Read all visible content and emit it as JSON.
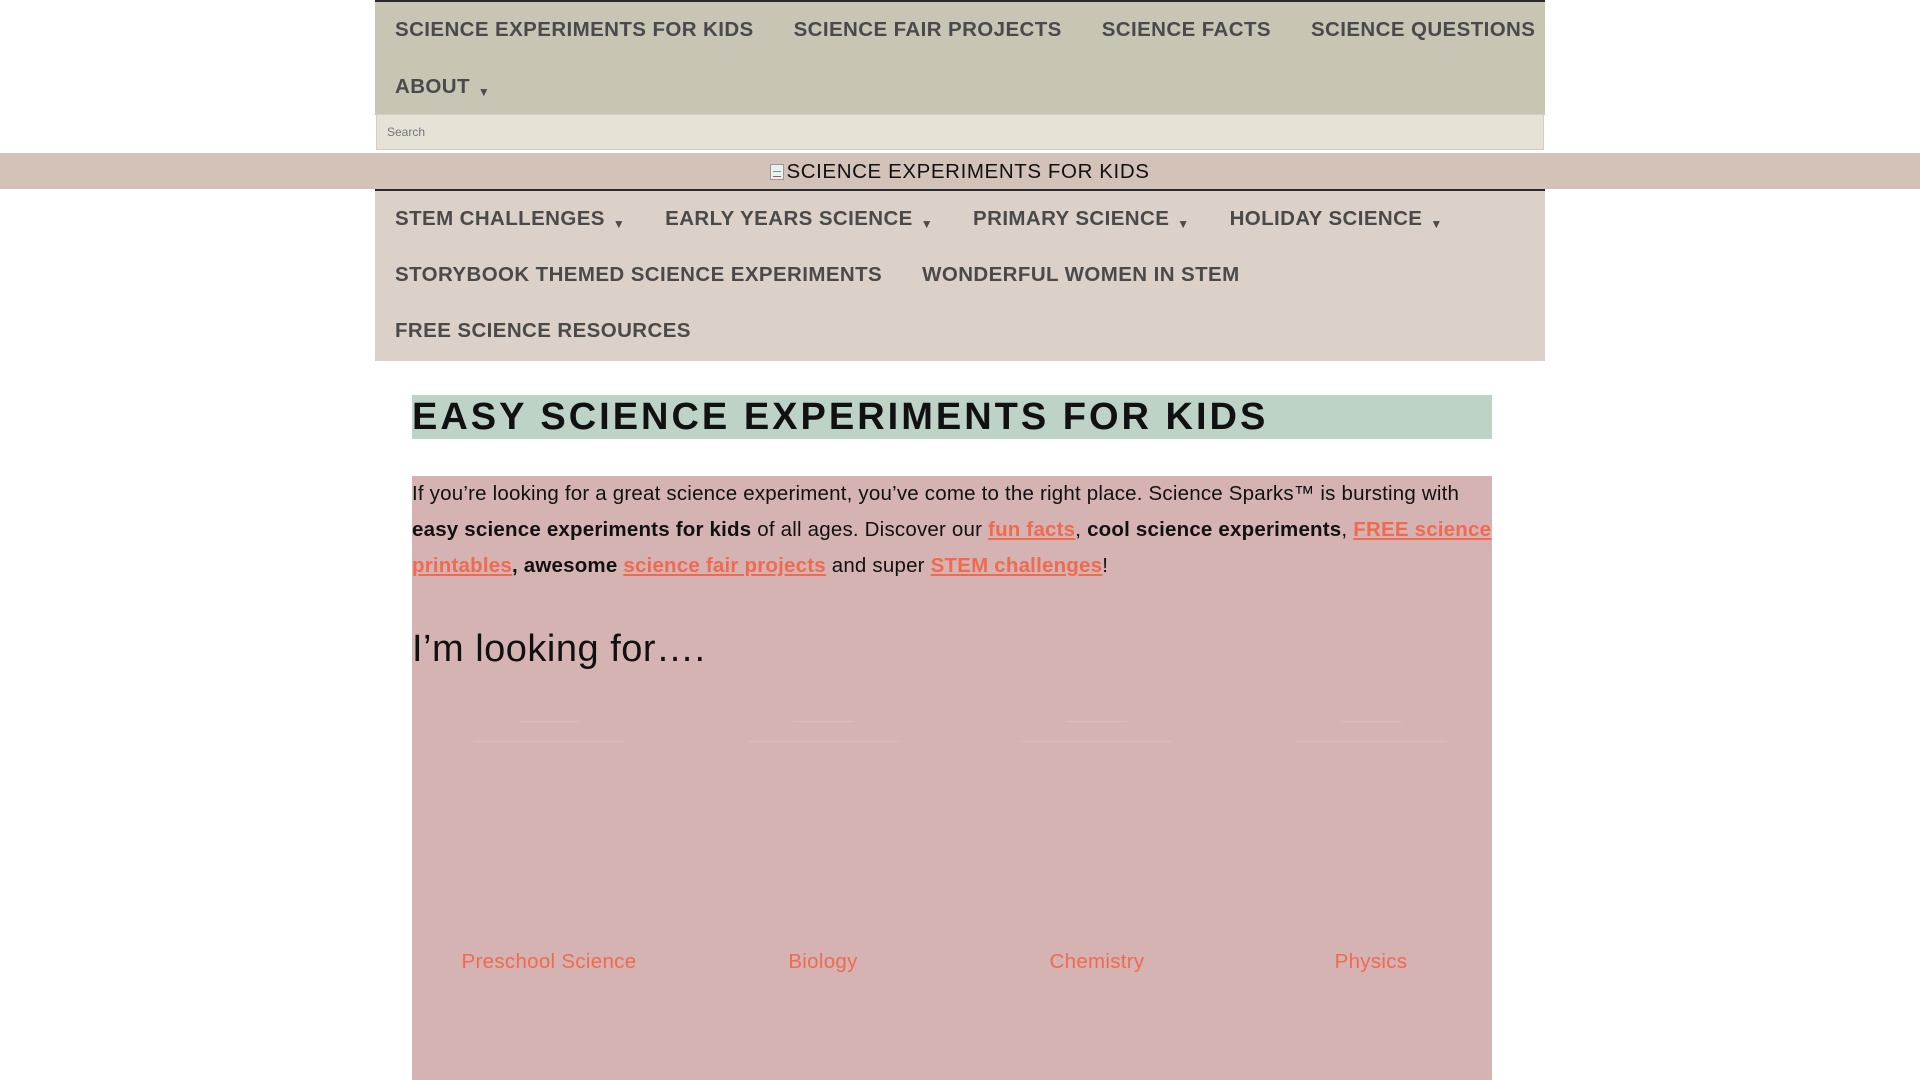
{
  "top_nav": {
    "row1": [
      {
        "label": "SCIENCE EXPERIMENTS FOR KIDS"
      },
      {
        "label": "SCIENCE FAIR PROJECTS"
      },
      {
        "label": "SCIENCE FACTS"
      },
      {
        "label": "SCIENCE QUESTIONS"
      }
    ],
    "about": {
      "label": "ABOUT",
      "icon": "chevron-down-icon"
    }
  },
  "search": {
    "placeholder": "Search"
  },
  "logo": {
    "alt": "SCIENCE EXPERIMENTS FOR KIDS",
    "icon": "broken-image-icon"
  },
  "main_nav": {
    "row1": [
      {
        "label": "STEM CHALLENGES",
        "has_submenu": true
      },
      {
        "label": "EARLY YEARS SCIENCE",
        "has_submenu": true
      },
      {
        "label": "PRIMARY SCIENCE",
        "has_submenu": true
      },
      {
        "label": "HOLIDAY SCIENCE",
        "has_submenu": true
      }
    ],
    "row2": [
      {
        "label": "STORYBOOK THEMED SCIENCE EXPERIMENTS"
      },
      {
        "label": "WONDERFUL WOMEN IN STEM"
      }
    ],
    "row3": [
      {
        "label": "FREE SCIENCE RESOURCES"
      }
    ]
  },
  "content": {
    "title": "EASY SCIENCE EXPERIMENTS FOR KIDS",
    "intro": {
      "t1": "If you’re looking for a great science experiment, you’ve come to the right place. Science Sparks™ is bursting with ",
      "b1": "easy science experiments for kids",
      "t2": " of all ages. Discover our ",
      "link1": "fun facts",
      "t3": ", ",
      "b2": "cool science experiments",
      "t4": ", ",
      "link2": "FREE science printables",
      "b3": ", awesome ",
      "link3": "science fair projects",
      "t5": " and super ",
      "link4": "STEM challenges",
      "t6": "!"
    },
    "looking_heading": "I’m looking for….",
    "categories": [
      {
        "label": "Preschool Science"
      },
      {
        "label": "Biology"
      },
      {
        "label": "Chemistry"
      },
      {
        "label": "Physics"
      }
    ]
  },
  "colors": {
    "top_nav_bg": "#c9c5b5",
    "logo_band_bg": "#d3c2b8",
    "main_nav_bg": "#dcd1c8",
    "title_bg": "#bcd3c6",
    "intro_bg": "#d5b3b3",
    "link": "#f06a50"
  }
}
